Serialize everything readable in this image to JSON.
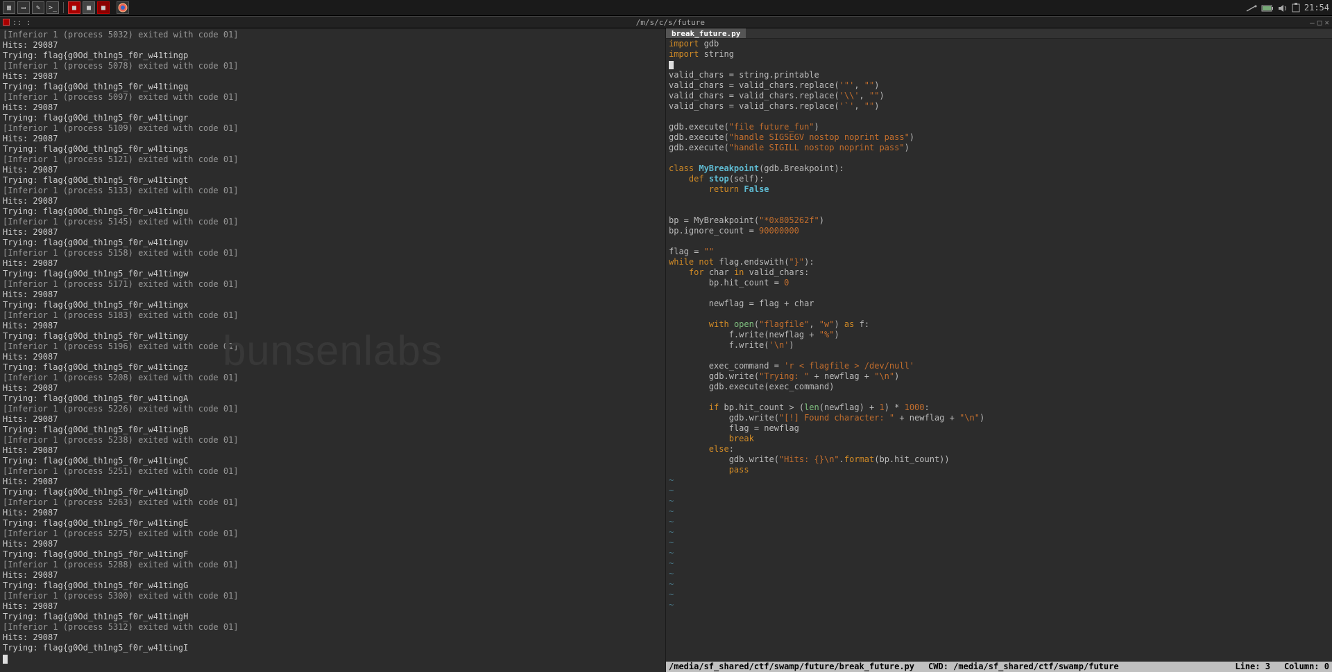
{
  "system": {
    "clock": "21:54"
  },
  "window": {
    "title_path": "/m/s/c/s/future",
    "title_prefix": ":: :"
  },
  "terminal": {
    "lines": [
      {
        "t": "inf",
        "pid": "5032"
      },
      {
        "t": "hits"
      },
      {
        "t": "try",
        "s": "p"
      },
      {
        "t": "inf",
        "pid": "5078"
      },
      {
        "t": "hits"
      },
      {
        "t": "try",
        "s": "q"
      },
      {
        "t": "inf",
        "pid": "5097"
      },
      {
        "t": "hits"
      },
      {
        "t": "try",
        "s": "r"
      },
      {
        "t": "inf",
        "pid": "5109"
      },
      {
        "t": "hits"
      },
      {
        "t": "try",
        "s": "s"
      },
      {
        "t": "inf",
        "pid": "5121"
      },
      {
        "t": "hits"
      },
      {
        "t": "try",
        "s": "t"
      },
      {
        "t": "inf",
        "pid": "5133"
      },
      {
        "t": "hits"
      },
      {
        "t": "try",
        "s": "u"
      },
      {
        "t": "inf",
        "pid": "5145"
      },
      {
        "t": "hits"
      },
      {
        "t": "try",
        "s": "v"
      },
      {
        "t": "inf",
        "pid": "5158"
      },
      {
        "t": "hits"
      },
      {
        "t": "try",
        "s": "w"
      },
      {
        "t": "inf",
        "pid": "5171"
      },
      {
        "t": "hits"
      },
      {
        "t": "try",
        "s": "x"
      },
      {
        "t": "inf",
        "pid": "5183"
      },
      {
        "t": "hits"
      },
      {
        "t": "try",
        "s": "y"
      },
      {
        "t": "inf",
        "pid": "5196"
      },
      {
        "t": "hits"
      },
      {
        "t": "try",
        "s": "z"
      },
      {
        "t": "inf",
        "pid": "5208"
      },
      {
        "t": "hits"
      },
      {
        "t": "try",
        "s": "A"
      },
      {
        "t": "inf",
        "pid": "5226"
      },
      {
        "t": "hits"
      },
      {
        "t": "try",
        "s": "B"
      },
      {
        "t": "inf",
        "pid": "5238"
      },
      {
        "t": "hits"
      },
      {
        "t": "try",
        "s": "C"
      },
      {
        "t": "inf",
        "pid": "5251"
      },
      {
        "t": "hits"
      },
      {
        "t": "try",
        "s": "D"
      },
      {
        "t": "inf",
        "pid": "5263"
      },
      {
        "t": "hits"
      },
      {
        "t": "try",
        "s": "E"
      },
      {
        "t": "inf",
        "pid": "5275"
      },
      {
        "t": "hits"
      },
      {
        "t": "try",
        "s": "F"
      },
      {
        "t": "inf",
        "pid": "5288"
      },
      {
        "t": "hits"
      },
      {
        "t": "try",
        "s": "G"
      },
      {
        "t": "inf",
        "pid": "5300"
      },
      {
        "t": "hits"
      },
      {
        "t": "try",
        "s": "H"
      },
      {
        "t": "inf",
        "pid": "5312"
      },
      {
        "t": "hits"
      },
      {
        "t": "try",
        "s": "I"
      }
    ],
    "hits_value": "29087",
    "flag_prefix": "flag{g0Od_th1ng5_f0r_w41ting",
    "inferior_tmpl": "[Inferior 1 (process {pid}) exited with code 01]"
  },
  "editor": {
    "tab": "break_future.py",
    "status": {
      "filepath": "/media/sf_shared/ctf/swamp/future/break_future.py",
      "cwd_label": "CWD:",
      "cwd": "/media/sf_shared/ctf/swamp/future",
      "line_label": "Line:",
      "line": "3",
      "col_label": "Column:",
      "col": "0"
    },
    "src": {
      "l1": "import gdb",
      "l2": "import string",
      "l4": "valid_chars = string.printable",
      "l5": "valid_chars = valid_chars.replace('\"', \"\")",
      "l6": "valid_chars = valid_chars.replace('\\\\', \"\")",
      "l7": "valid_chars = valid_chars.replace('`', \"\")",
      "l9": "gdb.execute(\"file future_fun\")",
      "l10": "gdb.execute(\"handle SIGSEGV nostop noprint pass\")",
      "l11": "gdb.execute(\"handle SIGILL nostop noprint pass\")",
      "l13": "class MyBreakpoint(gdb.Breakpoint):",
      "l14": "    def stop(self):",
      "l15": "        return False",
      "l18": "bp = MyBreakpoint(\"*0x805262f\")",
      "l19": "bp.ignore_count = 90000000",
      "l21": "flag = \"\"",
      "l22": "while not flag.endswith(\"}\"):",
      "l23": "    for char in valid_chars:",
      "l24": "        bp.hit_count = 0",
      "l26": "        newflag = flag + char",
      "l28": "        with open(\"flagfile\", \"w\") as f:",
      "l29": "            f.write(newflag + \"%\")",
      "l30": "            f.write('\\n')",
      "l32": "        exec_command = 'r < flagfile > /dev/null'",
      "l33": "        gdb.write(\"Trying: \" + newflag + \"\\n\")",
      "l34": "        gdb.execute(exec_command)",
      "l36": "        if bp.hit_count > (len(newflag) + 1) * 1000:",
      "l37": "            gdb.write(\"[!] Found character: \" + newflag + \"\\n\")",
      "l38": "            flag = newflag",
      "l39": "            break",
      "l40": "        else:",
      "l41": "            gdb.write(\"Hits: {}\\n\".format(bp.hit_count))",
      "l42": "            pass"
    }
  },
  "watermark": "bunsenlabs"
}
